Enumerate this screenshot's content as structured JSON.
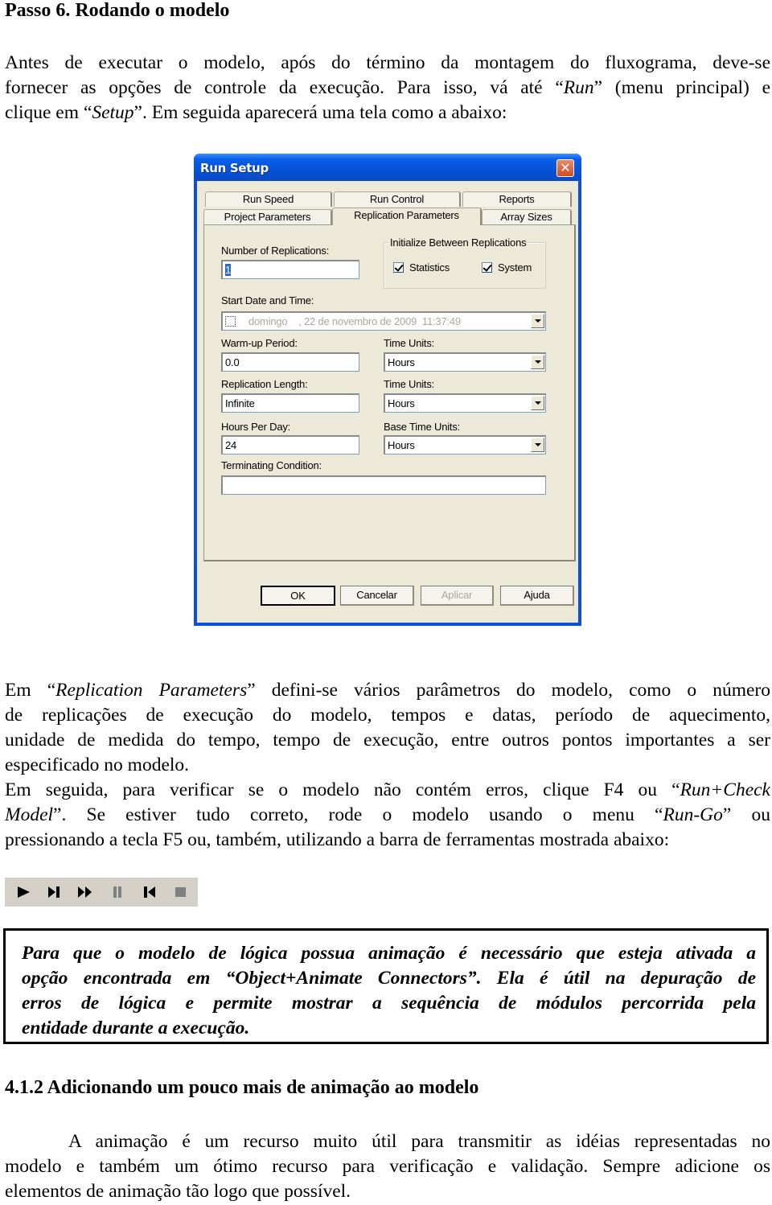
{
  "document": {
    "heading": "Passo 6. Rodando o modelo",
    "intro_lines": [
      [
        "Antes de executar o modelo, após do término da montagem do fluxograma, deve-se"
      ],
      [
        "fornecer as opções de controle da execução. Para isso, vá até “",
        "Run",
        "” (menu principal) e"
      ],
      [
        "clique em “",
        "Setup",
        "”. Em seguida aparecerá uma tela como a abaixo:"
      ]
    ],
    "paragraph2": {
      "l1a": "Em “",
      "l1i": "Replication Parameters",
      "l1b": "” defini-se vários parâmetros do modelo, como o número",
      "l2": "de replicações de execução do modelo, tempos e datas, período de aquecimento,",
      "l3": "unidade de medida do tempo, tempo de execução, entre outros pontos importantes a ser",
      "l4": "especificado no modelo.",
      "l5a": "Em seguida, para verificar se o modelo não contém erros, clique F4 ou “",
      "l5i": "Run+Check",
      "l6i": "Model",
      "l6a": "”. Se estiver tudo correto, rode o modelo usando o menu “",
      "l6i2": "Run-Go",
      "l6b": "” ou",
      "l7": "pressionando a tecla F5 ou, também, utilizando a barra de ferramentas mostrada abaixo:"
    },
    "note": {
      "lines": [
        "Para que o modelo de lógica possua animação é necessário que esteja ativada a",
        "opção encontrada em “Object+Animate Connectors”. Ela é útil na depuração de",
        "erros de lógica e permite mostrar a sequência de módulos percorrida pela",
        "entidade durante a execução."
      ]
    },
    "section_heading": "4.1.2 Adicionando um pouco mais de animação ao modelo",
    "closing_lines": [
      "A animação é um recurso muito útil para transmitir as idéias representadas no",
      "modelo e também um ótimo recurso para verificação e validação. Sempre adicione os",
      "elementos de animação tão logo que possível."
    ]
  },
  "dialog": {
    "title": "Run Setup",
    "close_icon": "close-icon",
    "tabs_row1": [
      "Run Speed",
      "Run Control",
      "Reports"
    ],
    "tabs_row2": [
      "Project Parameters",
      "Replication Parameters",
      "Array Sizes"
    ],
    "active_tab": "Replication Parameters",
    "number_of_replications": {
      "label": "Number of Replications:",
      "value": "1"
    },
    "init_group": {
      "title": "Initialize Between Replications",
      "statistics": {
        "label": "Statistics",
        "checked": true
      },
      "system": {
        "label": "System",
        "checked": true
      }
    },
    "start_date": {
      "label": "Start Date and Time:",
      "value": "domingo    , 22 de novembro de 2009  11:37:49",
      "checked": false
    },
    "warmup": {
      "label": "Warm-up Period:",
      "value": "0.0"
    },
    "warmup_units": {
      "label": "Time Units:",
      "value": "Hours"
    },
    "replication_length": {
      "label": "Replication Length:",
      "value": "Infinite"
    },
    "length_units": {
      "label": "Time Units:",
      "value": "Hours"
    },
    "hours_per_day": {
      "label": "Hours Per Day:",
      "value": "24"
    },
    "base_time_units": {
      "label": "Base Time Units:",
      "value": "Hours"
    },
    "terminating_condition": {
      "label": "Terminating Condition:",
      "value": ""
    },
    "buttons": {
      "ok": "OK",
      "cancel": "Cancelar",
      "apply": "Aplicar",
      "help": "Ajuda"
    }
  },
  "toolbar": {
    "icons": [
      "go-icon",
      "step-icon",
      "fast-forward-icon",
      "pause-icon",
      "start-over-icon",
      "end-icon"
    ]
  }
}
